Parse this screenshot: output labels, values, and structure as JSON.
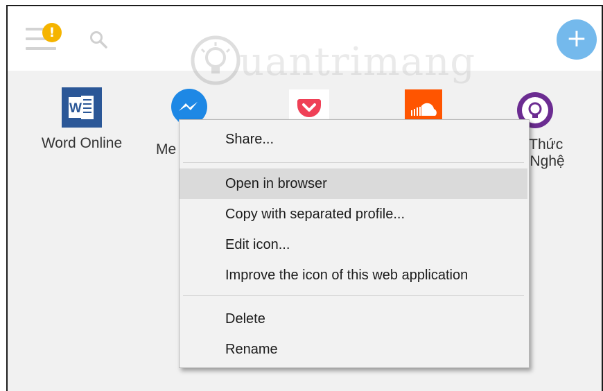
{
  "toolbar": {
    "menu_icon": "hamburger-menu-icon",
    "warning_badge": "!",
    "search_icon": "search-icon",
    "add_button": "+",
    "accent": "#74b9ec",
    "badge_color": "#f5b400"
  },
  "watermark": {
    "text": "uantrimang",
    "icon": "lightbulb-logo"
  },
  "apps": [
    {
      "label": "Word Online",
      "icon": "word-icon",
      "color": "#2b5797"
    },
    {
      "label": "Me",
      "icon": "messenger-icon",
      "color": "#1e88e5"
    },
    {
      "label": "",
      "icon": "pocket-icon",
      "color": "#ef4056"
    },
    {
      "label": "",
      "icon": "soundcloud-icon",
      "color": "#ff5500"
    },
    {
      "label_line1": "n Thức",
      "label_line2": "g Nghệ",
      "icon": "lightbulb-app-icon",
      "color": "#6b2c91"
    }
  ],
  "context_menu": {
    "items": [
      {
        "label": "Share..."
      },
      {
        "label": "Open in browser"
      },
      {
        "label": "Copy with separated profile..."
      },
      {
        "label": "Edit icon..."
      },
      {
        "label": "Improve the icon of this web application"
      },
      {
        "label": "Delete"
      },
      {
        "label": "Rename"
      }
    ],
    "hovered": "Open in browser"
  }
}
